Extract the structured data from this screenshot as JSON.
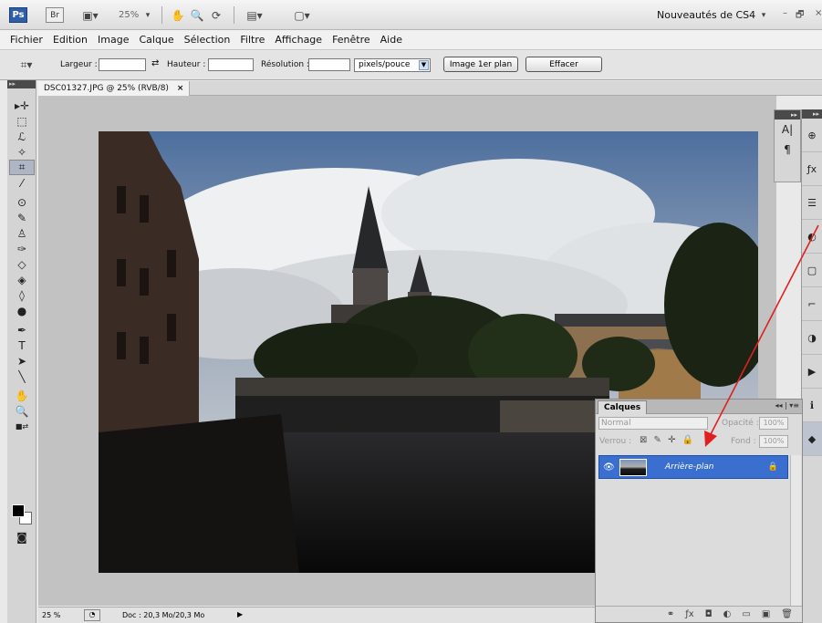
{
  "app": {
    "logo": "Ps",
    "bridge": "Br",
    "zoom": "25%",
    "workspace": "Nouveautés de CS4",
    "window_controls": [
      "–",
      "🗗",
      "×"
    ]
  },
  "menu": [
    "Fichier",
    "Edition",
    "Image",
    "Calque",
    "Sélection",
    "Filtre",
    "Affichage",
    "Fenêtre",
    "Aide"
  ],
  "options_bar": {
    "width_label": "Largeur :",
    "width_value": "",
    "height_label": "Hauteur :",
    "height_value": "",
    "resolution_label": "Résolution :",
    "resolution_value": "",
    "unit": "pixels/pouce",
    "front_image_button": "Image 1er plan",
    "clear_button": "Effacer"
  },
  "document": {
    "tab_title": "DSC01327.JPG @ 25% (RVB/8)",
    "close": "×"
  },
  "status": {
    "zoom": "25 %",
    "doc_size": "Doc : 20,3 Mo/20,3 Mo"
  },
  "layers_panel": {
    "tab": "Calques",
    "blend_mode": "Normal",
    "opacity_label": "Opacité :",
    "opacity_value": "100%",
    "lock_label": "Verrou :",
    "fill_label": "Fond :",
    "fill_value": "100%",
    "layer_name": "Arrière-plan"
  },
  "colors": {
    "accent": "#3a6fd0",
    "annotation": "#e02020"
  }
}
